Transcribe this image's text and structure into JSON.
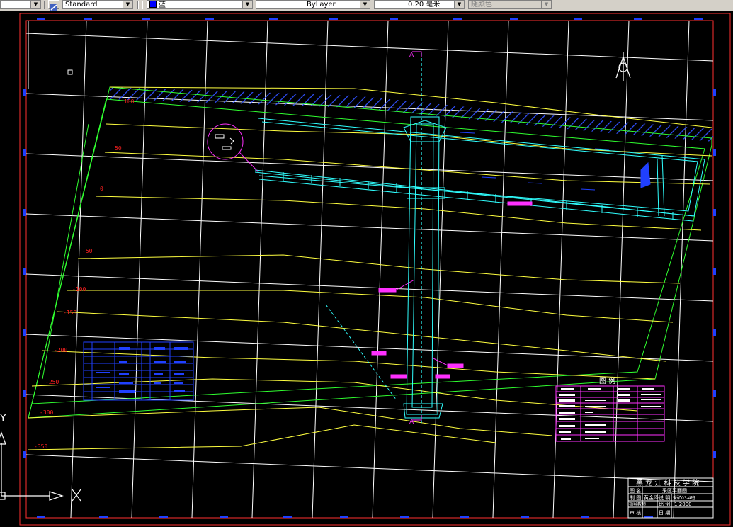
{
  "toolbar": {
    "text_style": "Standard",
    "color": "蓝",
    "color_swatch": "#0000ff",
    "linetype": "ByLayer",
    "lineweight": "0.20 毫米",
    "plot_style": "随颜色"
  },
  "drawing": {
    "contour_labels": [
      "100",
      "50",
      "0",
      "-50",
      "-100",
      "-150",
      "-200",
      "-250",
      "-300",
      "-350"
    ],
    "section_mark": "A",
    "legend_title": "图  例",
    "title_block": {
      "school": "黑 龙 江 科 技 学 院",
      "drawing_name": "采区平面图",
      "row1": [
        "图 名",
        "",
        "采区平面图"
      ],
      "row2": [
        "制 图",
        "黄金泽",
        "说 明",
        "采矿03-4班"
      ],
      "row3": [
        "指导教师",
        "",
        "比 例",
        "1:2000"
      ],
      "row4": [
        "审 核",
        "",
        "日 期",
        ""
      ]
    }
  },
  "ucs": {
    "x_label": "X",
    "y_label": "Y"
  }
}
